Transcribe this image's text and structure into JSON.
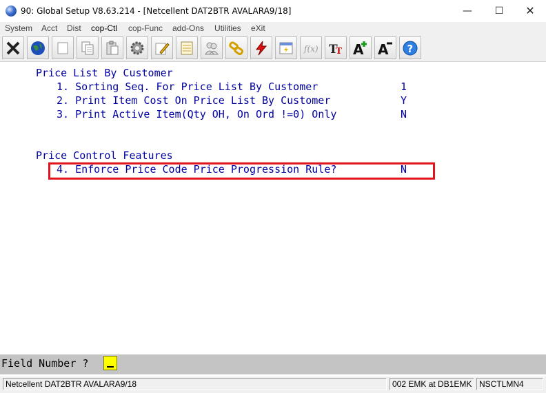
{
  "window": {
    "title": "90: Global Setup V8.63.214 - [Netcellent DAT2BTR AVALARA9/18]",
    "minimize_glyph": "—",
    "maximize_glyph": "☐",
    "close_glyph": "✕"
  },
  "menu": [
    {
      "label": "System"
    },
    {
      "label": "Acct"
    },
    {
      "label": "Dist"
    },
    {
      "label": "cop-Ctl"
    },
    {
      "label": "cop-Func"
    },
    {
      "label": "add-Ons"
    },
    {
      "label": "Utilities"
    },
    {
      "label": "eXit"
    }
  ],
  "toolbar": {
    "icons": [
      "exit-icon",
      "globe-icon",
      "blank-icon",
      "copy-icon",
      "paste-icon",
      "settings-icon",
      "edit-icon",
      "notepad-icon",
      "users-icon",
      "link-icon",
      "flash-icon",
      "report-icon",
      "function-icon",
      "font-size-icon",
      "increase-font-icon",
      "decrease-font-icon",
      "help-icon"
    ],
    "font_size_glyph": "TT",
    "increase_glyph": "A",
    "decrease_glyph": "A",
    "help_glyph": "?",
    "function_glyph": "f(x)"
  },
  "screen": {
    "section1_title": "Price List By Customer",
    "items": [
      {
        "text": "1. Sorting Seq. For Price List By Customer",
        "value": "1"
      },
      {
        "text": "2. Print Item Cost On Price List By Customer",
        "value": "Y"
      },
      {
        "text": "3. Print Active Item(Qty OH, On Ord !=0) Only",
        "value": "N"
      }
    ],
    "section2_title": "Price Control Features",
    "item4": {
      "text": "4. Enforce Price Code Price Progression Rule?",
      "value": "N"
    },
    "highlight_color": "#e0141e"
  },
  "prompt": {
    "label": "Field Number ?"
  },
  "status": {
    "company": "Netcellent DAT2BTR AVALARA9/18",
    "user": "002 EMK at DB1EMK",
    "machine": "NSCTLMN4"
  }
}
